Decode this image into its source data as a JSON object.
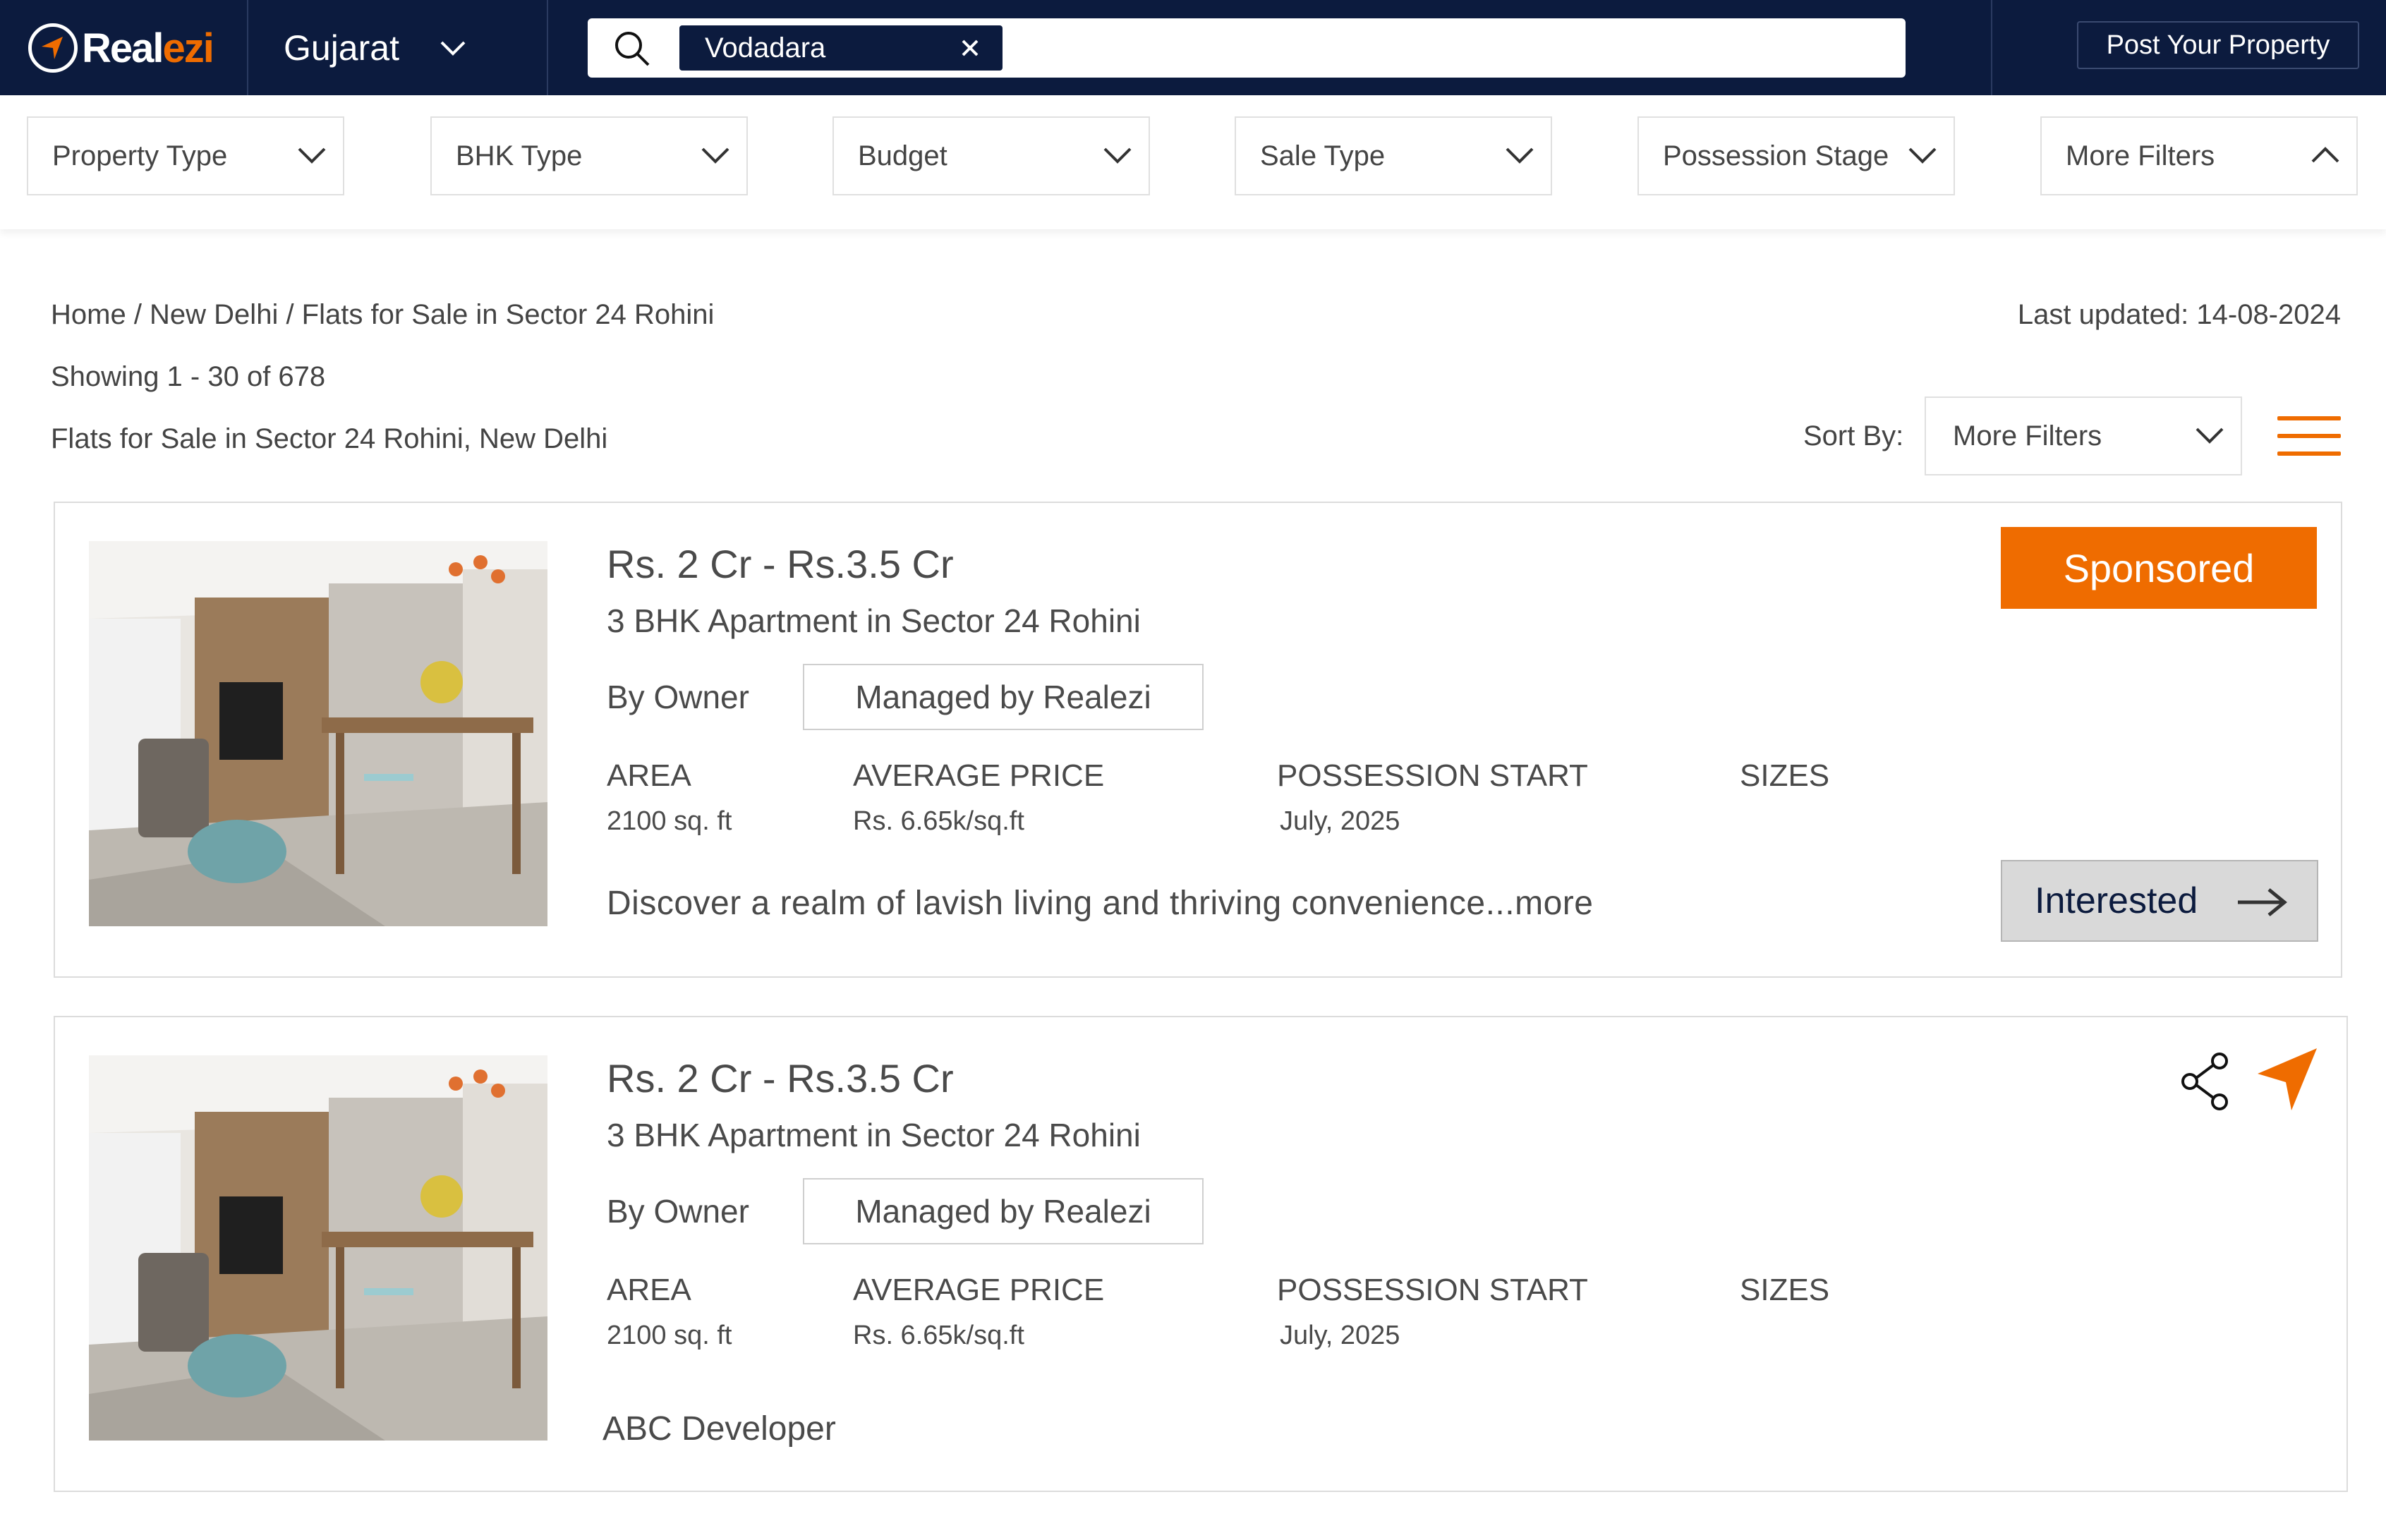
{
  "header": {
    "logo_text_main": "Real",
    "logo_text_accent": "ezi",
    "state": "Gujarat",
    "search_chip": "Vodadara",
    "post_button": "Post Your Property"
  },
  "filters": [
    {
      "label": "Property Type",
      "icon": "chevron-down-icon"
    },
    {
      "label": "BHK Type",
      "icon": "chevron-down-icon"
    },
    {
      "label": "Budget",
      "icon": "chevron-down-icon"
    },
    {
      "label": "Sale Type",
      "icon": "chevron-down-icon"
    },
    {
      "label": "Possession Stage",
      "icon": "chevron-down-icon"
    },
    {
      "label": "More Filters",
      "icon": "chevron-up-icon"
    }
  ],
  "meta": {
    "breadcrumb": "Home / New Delhi / Flats for Sale in Sector 24 Rohini",
    "last_updated": "Last updated: 14-08-2024",
    "showing": "Showing 1 - 30 of 678",
    "subtitle": "Flats for Sale in Sector 24 Rohini, New Delhi",
    "sort_label": "Sort By:",
    "sort_value": "More Filters"
  },
  "listings": [
    {
      "price": "Rs. 2 Cr - Rs.3.5 Cr",
      "property_type": "3 BHK Apartment in Sector 24 Rohini",
      "owner": "By Owner",
      "managed": "Managed by Realezi",
      "labels": {
        "area": "AREA",
        "avg_price": "AVERAGE PRICE",
        "possession": "POSSESSION START",
        "sizes": "SIZES"
      },
      "values": {
        "area": "2100 sq. ft",
        "avg_price": "Rs. 6.65k/sq.ft",
        "possession": "July, 2025"
      },
      "description": "Discover a realm of lavish living and thriving convenience...more",
      "badge": "Sponsored",
      "cta": "Interested"
    },
    {
      "price": "Rs. 2 Cr - Rs.3.5 Cr",
      "property_type": "3 BHK Apartment in Sector 24 Rohini",
      "owner": "By Owner",
      "managed": "Managed by Realezi",
      "labels": {
        "area": "AREA",
        "avg_price": "AVERAGE PRICE",
        "possession": "POSSESSION START",
        "sizes": "SIZES"
      },
      "values": {
        "area": "2100 sq. ft",
        "avg_price": "Rs. 6.65k/sq.ft",
        "possession": "July, 2025"
      },
      "developer": "ABC Developer"
    }
  ],
  "colors": {
    "navy": "#0c1b3e",
    "accent": "#ef6c00",
    "border": "#e0e0e0"
  }
}
